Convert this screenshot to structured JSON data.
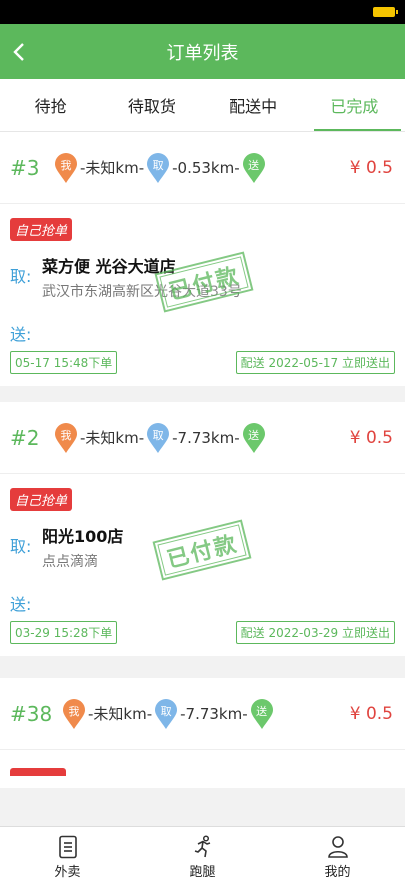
{
  "nav": {
    "title": "订单列表"
  },
  "tabs": [
    {
      "label": "待抢"
    },
    {
      "label": "待取货"
    },
    {
      "label": "配送中"
    },
    {
      "label": "已完成"
    }
  ],
  "colors": {
    "primary": "#5cb85c",
    "price": "#e0443f",
    "badge": "#e53c3c",
    "pickup_label": "#3fa0d8"
  },
  "pins": {
    "me": "我",
    "pick": "取",
    "send": "送"
  },
  "orders": [
    {
      "no": "#3",
      "dist1": "-未知km-",
      "dist2": "-0.53km-",
      "price": "¥ 0.5",
      "badge": "自己抢单",
      "pickup_label": "取:",
      "store": "菜方便 光谷大道店",
      "address": "武汉市东湖高新区光谷大道33号",
      "send_label": "送:",
      "stamp": "已付款",
      "order_time": "05-17 15:48下单",
      "delivery": "配送 2022-05-17 立即送出"
    },
    {
      "no": "#2",
      "dist1": "-未知km-",
      "dist2": "-7.73km-",
      "price": "¥ 0.5",
      "badge": "自己抢单",
      "pickup_label": "取:",
      "store": "阳光100店",
      "address": "点点滴滴",
      "send_label": "送:",
      "stamp": "已付款",
      "order_time": "03-29 15:28下单",
      "delivery": "配送 2022-03-29 立即送出"
    },
    {
      "no": "#38",
      "dist1": "-未知km-",
      "dist2": "-7.73km-",
      "price": "¥ 0.5"
    }
  ],
  "bottom": [
    {
      "label": "外卖",
      "icon": "list-icon"
    },
    {
      "label": "跑腿",
      "icon": "runner-icon"
    },
    {
      "label": "我的",
      "icon": "user-icon"
    }
  ]
}
